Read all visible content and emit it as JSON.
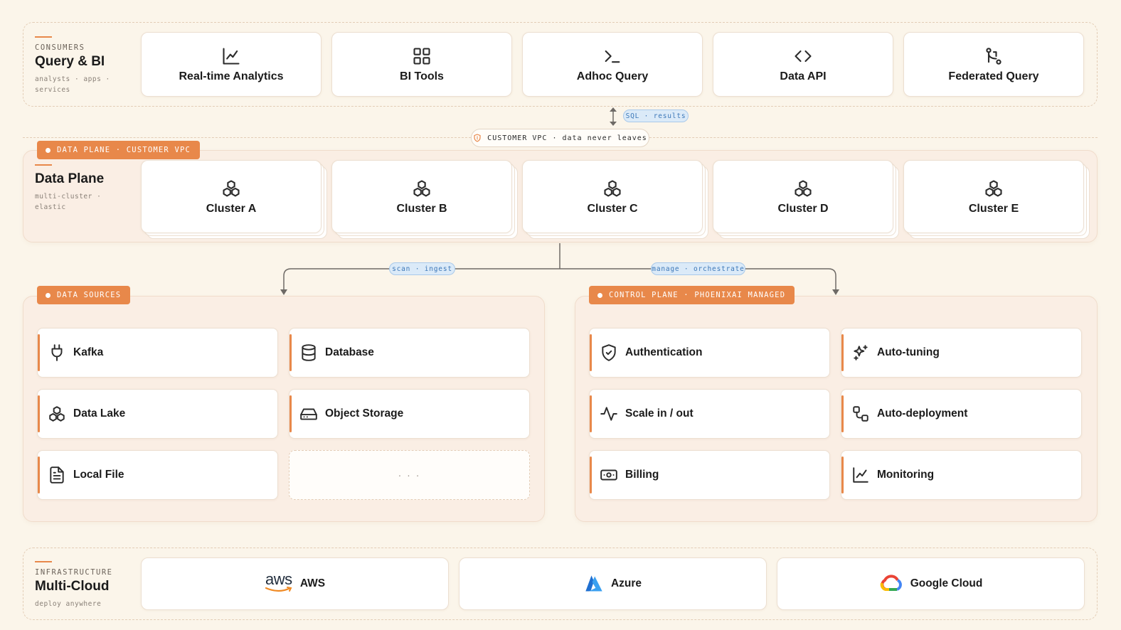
{
  "consumers": {
    "eyebrow": "CONSUMERS",
    "title": "Query & BI",
    "sub": "analysts · apps · services",
    "cards": [
      {
        "label": "Real-time Analytics",
        "icon": "line-chart-icon"
      },
      {
        "label": "BI Tools",
        "icon": "grid-icon"
      },
      {
        "label": "Adhoc Query",
        "icon": "terminal-icon"
      },
      {
        "label": "Data API",
        "icon": "code-icon"
      },
      {
        "label": "Federated Query",
        "icon": "git-merge-icon"
      }
    ]
  },
  "connector_top": {
    "label": "SQL · results"
  },
  "vpc_divider": {
    "label": "CUSTOMER VPC · data never leaves",
    "icon": "shield-icon"
  },
  "data_plane": {
    "tag": "DATA PLANE · CUSTOMER VPC",
    "title": "Data Plane",
    "sub": "multi-cluster · elastic",
    "clusters": [
      {
        "label": "Cluster A",
        "icon": "boxes-icon"
      },
      {
        "label": "Cluster B",
        "icon": "boxes-icon"
      },
      {
        "label": "Cluster C",
        "icon": "boxes-icon"
      },
      {
        "label": "Cluster D",
        "icon": "boxes-icon"
      },
      {
        "label": "Cluster E",
        "icon": "boxes-icon"
      }
    ]
  },
  "branch_left": {
    "label": "scan · ingest"
  },
  "branch_right": {
    "label": "manage · orchestrate"
  },
  "data_sources": {
    "tag": "DATA SOURCES",
    "items": [
      {
        "label": "Kafka",
        "icon": "plug-icon"
      },
      {
        "label": "Database",
        "icon": "database-icon"
      },
      {
        "label": "Data Lake",
        "icon": "boxes-icon"
      },
      {
        "label": "Object Storage",
        "icon": "hard-drive-icon"
      },
      {
        "label": "Local File",
        "icon": "file-text-icon"
      },
      {
        "label": "· · ·",
        "icon": "more-icon"
      }
    ]
  },
  "control_plane": {
    "tag": "CONTROL PLANE · PHOENIXAI MANAGED",
    "items": [
      {
        "label": "Authentication",
        "icon": "shield-check-icon"
      },
      {
        "label": "Auto-tuning",
        "icon": "sparkles-icon"
      },
      {
        "label": "Scale in / out",
        "icon": "activity-icon"
      },
      {
        "label": "Auto-deployment",
        "icon": "workflow-icon"
      },
      {
        "label": "Billing",
        "icon": "banknote-icon"
      },
      {
        "label": "Monitoring",
        "icon": "line-chart-icon"
      }
    ]
  },
  "infrastructure": {
    "eyebrow": "INFRASTRUCTURE",
    "title": "Multi-Cloud",
    "sub": "deploy anywhere",
    "clouds": [
      {
        "label": "AWS",
        "logo_text": "aws",
        "icon": "aws-logo"
      },
      {
        "label": "Azure",
        "icon": "azure-logo"
      },
      {
        "label": "Google Cloud",
        "icon": "google-cloud-logo"
      }
    ]
  },
  "colors": {
    "accent": "#e8884a",
    "background": "#fbf5ea",
    "panel": "#faeee4",
    "pill_blue": "#dbeaf8"
  }
}
